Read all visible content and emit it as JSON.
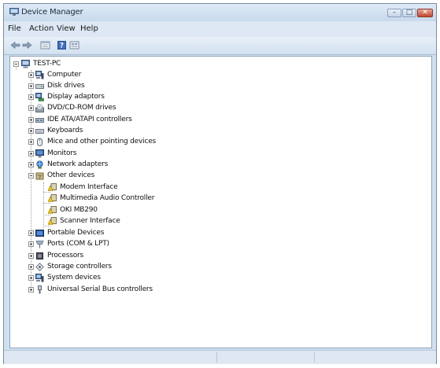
{
  "window": {
    "title": "Device Manager",
    "controls": {
      "minimize": "–",
      "maximize": "□",
      "close": "✕"
    }
  },
  "menu": [
    "File",
    "Action",
    "View",
    "Help"
  ],
  "toolbar": [
    "back-icon",
    "forward-icon",
    "properties-icon",
    "help-icon",
    "show-hidden-icon"
  ],
  "tree": {
    "root": "TEST-PC",
    "categories": [
      {
        "label": "Computer",
        "icon": "computer-icon"
      },
      {
        "label": "Disk drives",
        "icon": "disk-drive-icon"
      },
      {
        "label": "Display adaptors",
        "icon": "display-adapter-icon"
      },
      {
        "label": "DVD/CD-ROM drives",
        "icon": "dvd-drive-icon"
      },
      {
        "label": "IDE ATA/ATAPI controllers",
        "icon": "ide-controller-icon"
      },
      {
        "label": "Keyboards",
        "icon": "keyboard-icon"
      },
      {
        "label": "Mice and other pointing devices",
        "icon": "mouse-icon"
      },
      {
        "label": "Monitors",
        "icon": "monitor-icon"
      },
      {
        "label": "Network adapters",
        "icon": "network-adapter-icon"
      },
      {
        "label": "Other devices",
        "icon": "other-devices-icon",
        "expanded": true,
        "children": [
          "Modem Interface",
          "Multimedia Audio Controller",
          "OKI MB290",
          "Scanner Interface"
        ]
      },
      {
        "label": "Portable Devices",
        "icon": "portable-device-icon"
      },
      {
        "label": "Ports (COM & LPT)",
        "icon": "port-icon"
      },
      {
        "label": "Processors",
        "icon": "processor-icon"
      },
      {
        "label": "Storage controllers",
        "icon": "storage-controller-icon"
      },
      {
        "label": "System devices",
        "icon": "system-device-icon"
      },
      {
        "label": "Universal Serial Bus controllers",
        "icon": "usb-controller-icon"
      }
    ]
  }
}
